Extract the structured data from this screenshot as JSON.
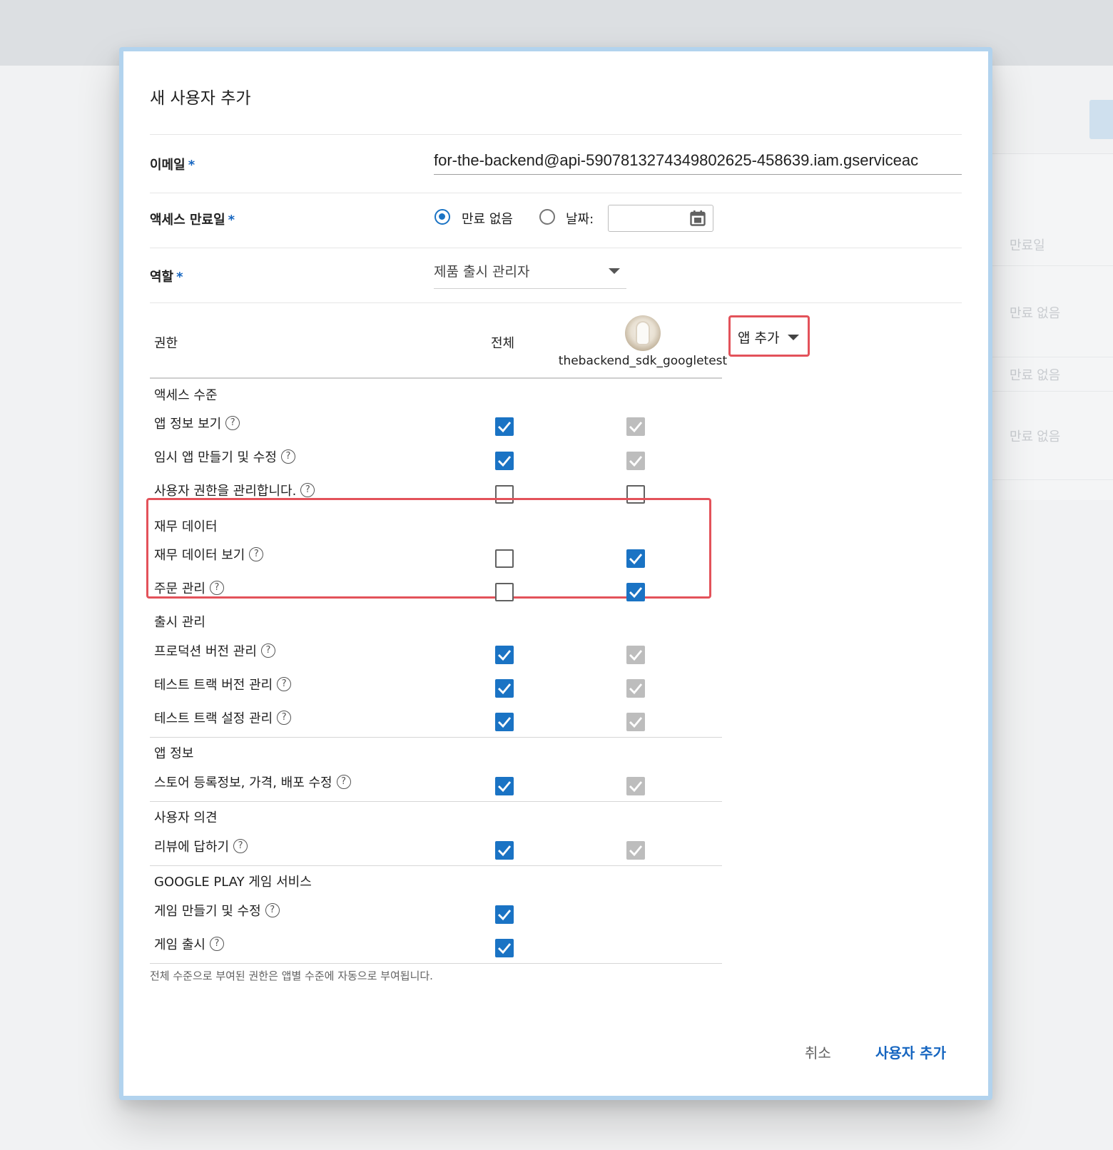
{
  "background": {
    "rows": [
      "만료일",
      "만료 없음",
      "만료 없음",
      "만료 없음"
    ]
  },
  "dialog": {
    "title": "새 사용자 추가",
    "email": {
      "label": "이메일",
      "required_mark": "*",
      "value": "for-the-backend@api-5907813274349802625-458639.iam.gserviceac"
    },
    "access_expiry": {
      "label": "액세스 만료일",
      "required_mark": "*",
      "option_none": "만료 없음",
      "option_date": "날짜:",
      "selected": "option_none",
      "date_value": ""
    },
    "role": {
      "label": "역할",
      "required_mark": "*",
      "value": "제품 출시 관리자"
    },
    "permissions": {
      "header": {
        "permission": "권한",
        "all": "전체",
        "app_name": "thebackend_sdk_googletest",
        "add_app": "앱 추가"
      },
      "sections": [
        {
          "title": "액세스 수준",
          "rows": [
            {
              "label": "앱 정보 보기",
              "all": "checked",
              "app": "disabled"
            },
            {
              "label": "임시 앱 만들기 및 수정",
              "all": "checked",
              "app": "disabled"
            },
            {
              "label": "사용자 권한을 관리합니다.",
              "all": "unchecked",
              "app": "unchecked"
            }
          ]
        },
        {
          "title": "재무 데이터",
          "rows": [
            {
              "label": "재무 데이터 보기",
              "all": "unchecked",
              "app": "checked"
            },
            {
              "label": "주문 관리",
              "all": "unchecked",
              "app": "checked"
            }
          ]
        },
        {
          "title": "출시 관리",
          "rows": [
            {
              "label": "프로덕션 버전 관리",
              "all": "checked",
              "app": "disabled"
            },
            {
              "label": "테스트 트랙 버전 관리",
              "all": "checked",
              "app": "disabled"
            },
            {
              "label": "테스트 트랙 설정 관리",
              "all": "checked",
              "app": "disabled"
            }
          ]
        },
        {
          "title": "앱 정보",
          "rows": [
            {
              "label": "스토어 등록정보, 가격, 배포 수정",
              "all": "checked",
              "app": "disabled"
            }
          ]
        },
        {
          "title": "사용자 의견",
          "rows": [
            {
              "label": "리뷰에 답하기",
              "all": "checked",
              "app": "disabled"
            }
          ]
        },
        {
          "title": "GOOGLE PLAY 게임 서비스",
          "rows": [
            {
              "label": "게임 만들기 및 수정",
              "all": "checked",
              "app": ""
            },
            {
              "label": "게임 출시",
              "all": "checked",
              "app": ""
            }
          ]
        }
      ],
      "help_glyph": "?",
      "footnote": "전체 수준으로 부여된 권한은 앱별 수준에 자동으로 부여됩니다."
    },
    "buttons": {
      "cancel": "취소",
      "submit": "사용자 추가"
    },
    "colors": {
      "accent": "#1a73c4",
      "highlight": "#e3525a",
      "disabled": "#bdbdbd"
    }
  }
}
